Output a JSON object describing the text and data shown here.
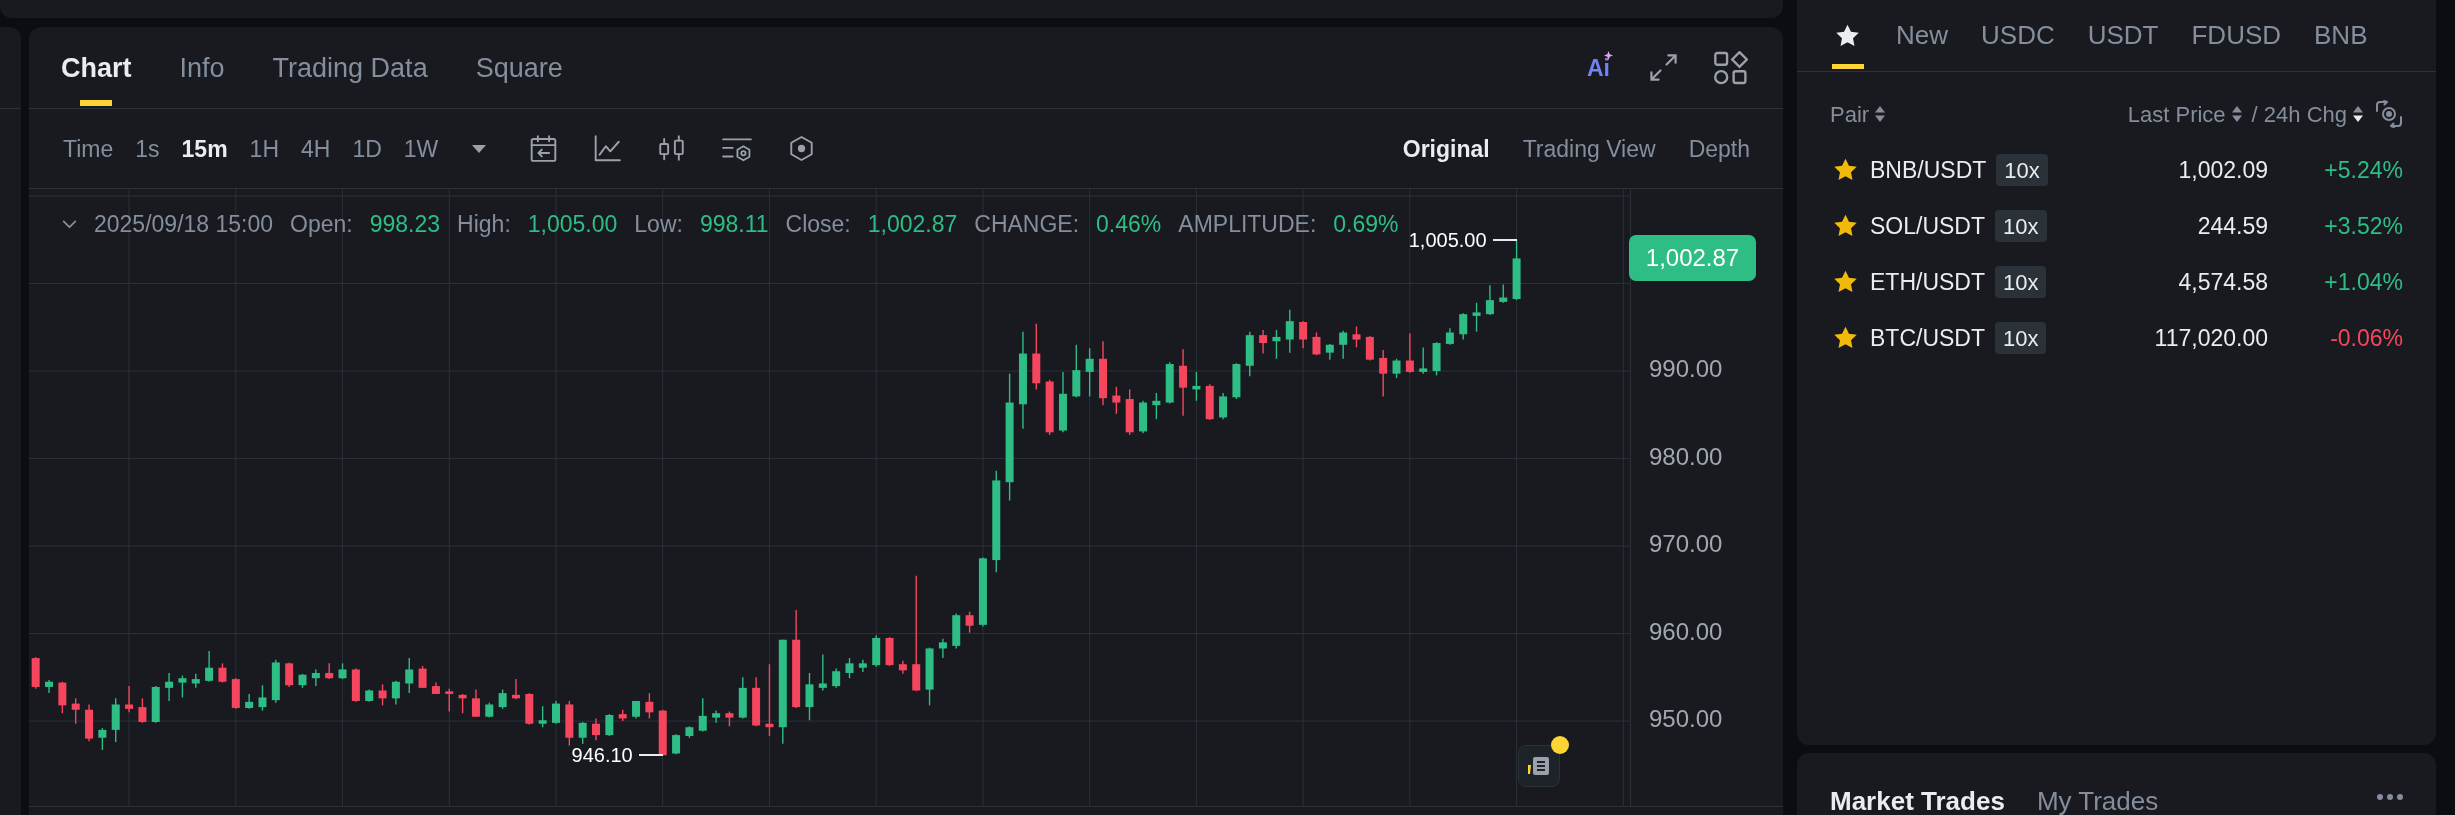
{
  "chart_panel": {
    "tabs": [
      {
        "label": "Chart",
        "selected": true
      },
      {
        "label": "Info",
        "selected": false
      },
      {
        "label": "Trading Data",
        "selected": false
      },
      {
        "label": "Square",
        "selected": false
      }
    ],
    "ai_button": {
      "label": "Ai"
    },
    "intervals": [
      {
        "label": "Time",
        "selected": false
      },
      {
        "label": "1s",
        "selected": false
      },
      {
        "label": "15m",
        "selected": true
      },
      {
        "label": "1H",
        "selected": false
      },
      {
        "label": "4H",
        "selected": false
      },
      {
        "label": "1D",
        "selected": false
      },
      {
        "label": "1W",
        "selected": false
      }
    ],
    "views": [
      {
        "label": "Original",
        "selected": true
      },
      {
        "label": "Trading View",
        "selected": false
      },
      {
        "label": "Depth",
        "selected": false
      }
    ],
    "legend": {
      "time": "2025/09/18 15:00",
      "fields": [
        {
          "label": "Open:",
          "value": "998.23"
        },
        {
          "label": "High:",
          "value": "1,005.00"
        },
        {
          "label": "Low:",
          "value": "998.11"
        },
        {
          "label": "Close:",
          "value": "1,002.87"
        },
        {
          "label": "CHANGE:",
          "value": "0.46%"
        },
        {
          "label": "AMPLITUDE:",
          "value": "0.69%"
        }
      ]
    },
    "last_price": "1,002.87",
    "extremes": {
      "high": "1,005.00",
      "low": "946.10"
    },
    "chart_data": {
      "type": "candlestick",
      "grid": true,
      "ylim": [
        940.3,
        1010.8
      ],
      "yticks": [
        {
          "value": 990,
          "label": "990.00"
        },
        {
          "value": 980,
          "label": "980.00"
        },
        {
          "value": 970,
          "label": "970.00"
        },
        {
          "value": 960,
          "label": "960.00"
        },
        {
          "value": 950,
          "label": "950.00"
        }
      ],
      "categories": [
        null,
        null,
        null,
        null,
        null,
        null,
        null,
        null,
        null,
        null,
        null,
        null,
        null,
        null,
        null,
        null,
        null,
        null,
        null,
        null,
        null,
        null,
        null,
        null,
        null,
        null,
        null,
        null,
        null,
        null,
        null,
        null,
        null,
        null,
        null,
        null,
        null,
        null,
        null,
        null,
        null,
        null,
        null,
        null,
        null,
        null,
        null,
        null,
        null,
        null,
        null,
        null,
        null,
        null,
        null,
        null,
        null,
        null,
        null,
        null,
        null,
        null,
        null,
        null,
        null,
        null,
        null,
        null,
        null,
        null,
        null,
        null,
        null,
        null,
        null,
        null,
        null,
        null,
        null,
        null,
        null,
        null,
        null,
        null,
        null,
        null,
        null,
        null,
        null,
        null,
        null,
        null,
        null,
        null,
        null,
        null,
        null,
        null,
        null,
        null,
        null,
        null,
        null,
        null,
        null,
        null,
        null,
        null,
        null,
        null,
        null,
        null,
        null,
        null,
        null,
        null,
        null,
        null,
        null,
        null
      ],
      "ohlc": [
        [
          957.2,
          957.3,
          953.7,
          953.9
        ],
        [
          953.9,
          954.7,
          953.2,
          954.5
        ],
        [
          954.4,
          954.5,
          950.9,
          951.8
        ],
        [
          952.0,
          952.6,
          949.7,
          951.3
        ],
        [
          951.3,
          951.9,
          947.7,
          948.0
        ],
        [
          948.1,
          949.2,
          946.7,
          949.0
        ],
        [
          949.0,
          952.6,
          947.6,
          951.9
        ],
        [
          951.9,
          954.0,
          951.0,
          951.4
        ],
        [
          951.6,
          952.6,
          949.8,
          949.9
        ],
        [
          949.9,
          954.0,
          949.8,
          953.9
        ],
        [
          953.8,
          955.5,
          952.3,
          954.5
        ],
        [
          954.4,
          955.2,
          952.7,
          954.9
        ],
        [
          954.3,
          955.4,
          953.8,
          954.8
        ],
        [
          954.6,
          958.0,
          954.5,
          956.1
        ],
        [
          956.1,
          956.6,
          954.4,
          954.5
        ],
        [
          954.8,
          954.9,
          951.4,
          951.5
        ],
        [
          951.5,
          953.1,
          951.4,
          952.2
        ],
        [
          951.6,
          954.1,
          951.2,
          952.7
        ],
        [
          952.4,
          957.0,
          952.1,
          956.7
        ],
        [
          956.6,
          956.7,
          953.9,
          954.1
        ],
        [
          954.1,
          955.4,
          953.8,
          955.3
        ],
        [
          954.9,
          955.9,
          954.0,
          955.5
        ],
        [
          955.5,
          956.6,
          954.8,
          954.9
        ],
        [
          954.9,
          956.6,
          954.8,
          955.9
        ],
        [
          955.9,
          956.0,
          952.2,
          952.3
        ],
        [
          952.3,
          953.6,
          952.2,
          953.5
        ],
        [
          953.5,
          954.2,
          951.8,
          952.6
        ],
        [
          952.6,
          954.6,
          951.9,
          954.5
        ],
        [
          954.3,
          957.2,
          953.2,
          955.9
        ],
        [
          956.0,
          956.3,
          953.8,
          953.8
        ],
        [
          954.0,
          954.4,
          953.1,
          953.1
        ],
        [
          953.4,
          953.7,
          951.1,
          953.1
        ],
        [
          953.0,
          953.1,
          950.9,
          952.6
        ],
        [
          952.6,
          953.6,
          950.5,
          950.5
        ],
        [
          950.5,
          952.1,
          950.4,
          951.9
        ],
        [
          951.6,
          953.6,
          951.4,
          953.2
        ],
        [
          953.0,
          954.8,
          952.5,
          952.6
        ],
        [
          953.1,
          953.2,
          949.6,
          949.7
        ],
        [
          949.7,
          951.7,
          949.3,
          950.1
        ],
        [
          949.8,
          952.3,
          949.7,
          952.0
        ],
        [
          951.9,
          952.3,
          947.2,
          948.1
        ],
        [
          948.1,
          949.9,
          947.4,
          949.8
        ],
        [
          949.7,
          950.3,
          947.8,
          948.4
        ],
        [
          948.4,
          950.8,
          948.3,
          950.7
        ],
        [
          950.8,
          951.3,
          950.0,
          950.3
        ],
        [
          950.5,
          952.3,
          950.3,
          952.3
        ],
        [
          952.2,
          953.2,
          950.3,
          951.0
        ],
        [
          951.2,
          951.3,
          946.1,
          946.1
        ],
        [
          946.3,
          948.5,
          946.2,
          948.4
        ],
        [
          948.3,
          949.4,
          948.1,
          949.3
        ],
        [
          948.9,
          952.6,
          948.8,
          950.6
        ],
        [
          950.4,
          951.2,
          949.8,
          950.9
        ],
        [
          950.9,
          951.1,
          949.4,
          950.4
        ],
        [
          950.4,
          955.0,
          950.3,
          953.8
        ],
        [
          953.8,
          955.0,
          949.4,
          949.5
        ],
        [
          949.7,
          956.5,
          948.3,
          949.3
        ],
        [
          949.3,
          959.3,
          947.4,
          959.3
        ],
        [
          959.3,
          962.7,
          951.5,
          951.6
        ],
        [
          951.6,
          955.5,
          950.1,
          954.2
        ],
        [
          953.8,
          957.6,
          953.5,
          954.3
        ],
        [
          954.0,
          956.0,
          953.8,
          955.7
        ],
        [
          955.5,
          957.2,
          954.9,
          956.6
        ],
        [
          956.1,
          957.0,
          955.6,
          956.6
        ],
        [
          956.4,
          959.8,
          956.2,
          959.5
        ],
        [
          959.5,
          959.6,
          956.3,
          956.4
        ],
        [
          956.5,
          956.9,
          955.4,
          955.8
        ],
        [
          956.5,
          966.6,
          953.4,
          953.5
        ],
        [
          953.6,
          958.4,
          951.8,
          958.3
        ],
        [
          958.3,
          959.4,
          957.2,
          959.0
        ],
        [
          958.6,
          962.3,
          958.3,
          962.1
        ],
        [
          962.1,
          962.5,
          960.1,
          960.9
        ],
        [
          961.0,
          968.7,
          960.8,
          968.6
        ],
        [
          968.4,
          978.6,
          967.0,
          977.5
        ],
        [
          977.3,
          989.7,
          975.2,
          986.4
        ],
        [
          986.2,
          994.5,
          983.4,
          992.0
        ],
        [
          992.0,
          995.4,
          987.9,
          988.6
        ],
        [
          988.8,
          989.0,
          982.7,
          983.0
        ],
        [
          983.2,
          989.9,
          983.0,
          987.4
        ],
        [
          987.1,
          993.0,
          987.0,
          990.1
        ],
        [
          989.9,
          992.6,
          987.1,
          991.4
        ],
        [
          991.4,
          993.4,
          986.1,
          986.9
        ],
        [
          987.2,
          988.2,
          985.1,
          986.4
        ],
        [
          986.8,
          987.9,
          982.7,
          983.0
        ],
        [
          983.1,
          986.6,
          982.9,
          986.4
        ],
        [
          986.1,
          987.5,
          984.5,
          986.6
        ],
        [
          986.4,
          991.0,
          986.3,
          990.8
        ],
        [
          990.6,
          992.5,
          984.9,
          988.1
        ],
        [
          987.9,
          989.9,
          986.6,
          988.3
        ],
        [
          988.3,
          988.5,
          984.4,
          984.5
        ],
        [
          984.7,
          987.5,
          984.5,
          987.1
        ],
        [
          987.0,
          990.9,
          986.8,
          990.8
        ],
        [
          990.6,
          994.5,
          989.4,
          994.1
        ],
        [
          994.1,
          994.7,
          992.0,
          993.2
        ],
        [
          993.4,
          994.7,
          991.4,
          993.9
        ],
        [
          993.6,
          997.0,
          992.1,
          995.7
        ],
        [
          995.6,
          995.7,
          992.6,
          993.6
        ],
        [
          993.9,
          994.4,
          991.8,
          991.9
        ],
        [
          992.1,
          993.1,
          991.3,
          993.0
        ],
        [
          993.0,
          994.6,
          991.4,
          994.4
        ],
        [
          994.2,
          995.1,
          992.7,
          993.6
        ],
        [
          993.9,
          994.0,
          991.2,
          991.3
        ],
        [
          991.5,
          992.4,
          987.1,
          989.7
        ],
        [
          989.7,
          991.4,
          989.2,
          991.2
        ],
        [
          991.2,
          994.3,
          989.8,
          989.9
        ],
        [
          989.9,
          992.7,
          989.7,
          990.3
        ],
        [
          990.0,
          993.3,
          989.5,
          993.2
        ],
        [
          993.1,
          994.9,
          993.0,
          994.4
        ],
        [
          994.2,
          996.6,
          993.6,
          996.5
        ],
        [
          996.3,
          997.8,
          994.5,
          996.7
        ],
        [
          996.5,
          999.8,
          996.4,
          998.1
        ],
        [
          997.9,
          999.9,
          997.8,
          998.4
        ],
        [
          998.23,
          1005.0,
          998.11,
          1002.87
        ],
        null,
        null,
        null,
        null,
        null,
        null,
        null,
        null
      ]
    },
    "notification": {
      "unread": true
    }
  },
  "markets_panel": {
    "tabs": [
      {
        "kind": "icon",
        "selected": true
      },
      {
        "kind": "text",
        "label": "New",
        "selected": false
      },
      {
        "kind": "text",
        "label": "USDC",
        "selected": false
      },
      {
        "kind": "text",
        "label": "USDT",
        "selected": false
      },
      {
        "kind": "text",
        "label": "FDUSD",
        "selected": false
      },
      {
        "kind": "text",
        "label": "BNB",
        "selected": false
      }
    ],
    "columns": [
      {
        "label": "Pair",
        "sort_descending": false
      },
      {
        "label": "Last Price",
        "sort_descending": false
      },
      {
        "label": "/ 24h Chg",
        "sort_descending": true
      }
    ],
    "rows": [
      {
        "pair": "BNB/USDT",
        "leverage": "10x",
        "price": "1,002.09",
        "change": "+5.24%",
        "color": "#2ebd85",
        "favorite": true
      },
      {
        "pair": "SOL/USDT",
        "leverage": "10x",
        "price": "244.59",
        "change": "+3.52%",
        "color": "#2ebd85",
        "favorite": true
      },
      {
        "pair": "ETH/USDT",
        "leverage": "10x",
        "price": "4,574.58",
        "change": "+1.04%",
        "color": "#2ebd85",
        "favorite": true
      },
      {
        "pair": "BTC/USDT",
        "leverage": "10x",
        "price": "117,020.00",
        "change": "-0.06%",
        "color": "#f6465d",
        "favorite": true
      }
    ]
  },
  "trades_panel": {
    "tabs": [
      {
        "label": "Market Trades",
        "selected": true
      },
      {
        "label": "My Trades",
        "selected": false
      }
    ]
  }
}
